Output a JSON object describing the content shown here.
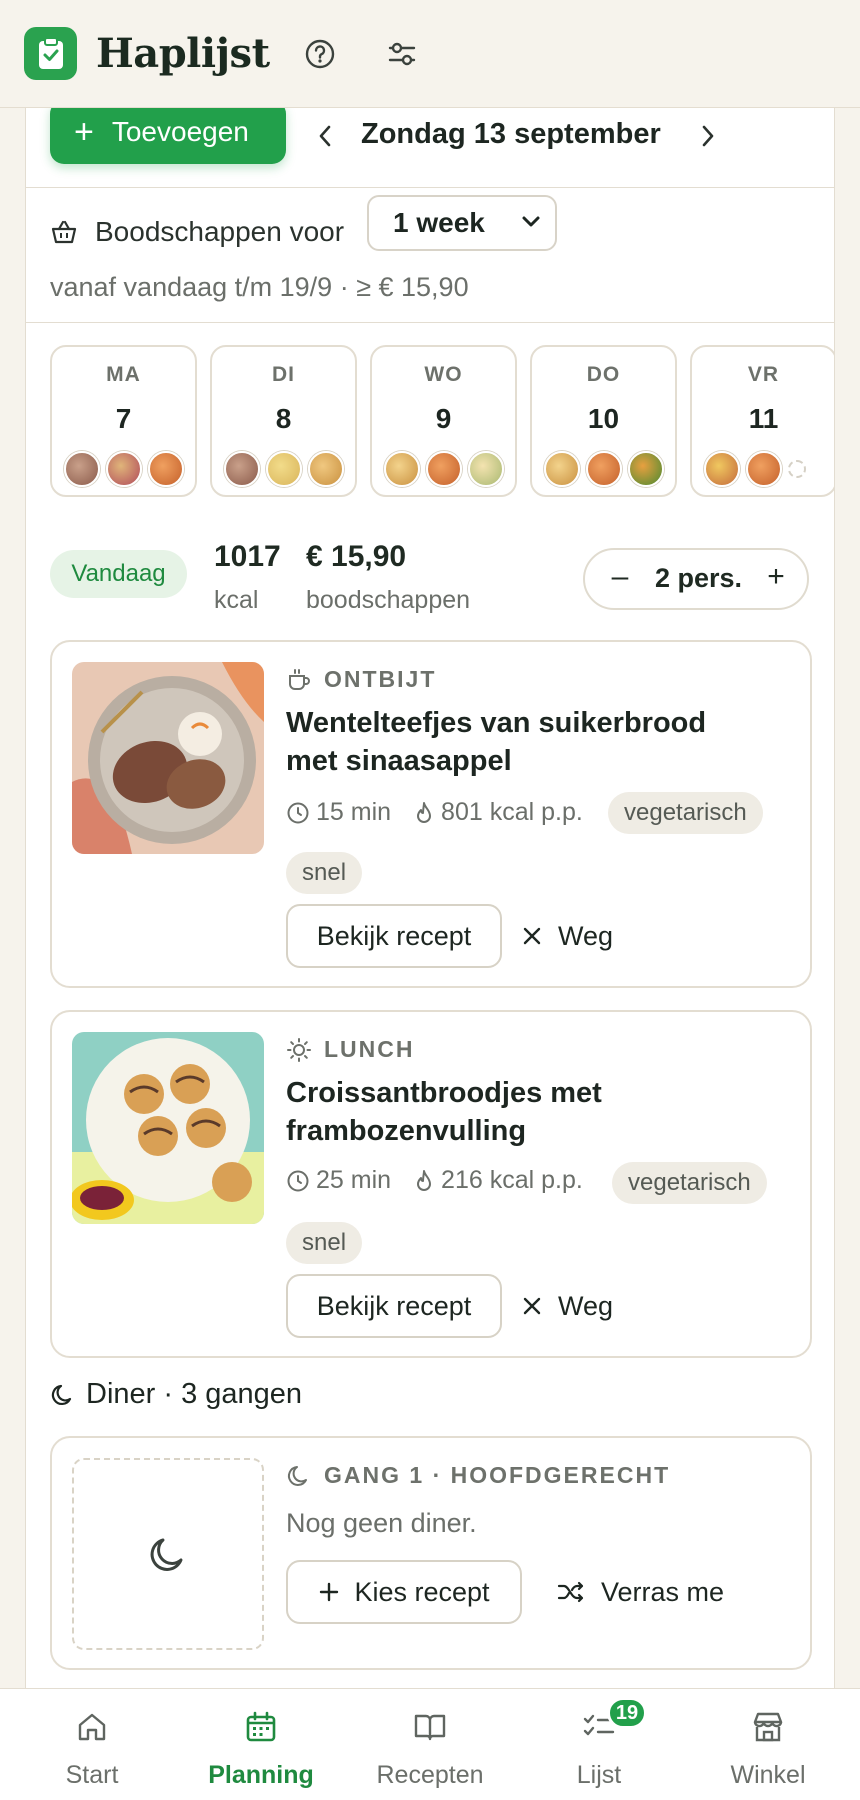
{
  "app": {
    "title": "Haplijst"
  },
  "header": {
    "help_icon": "help-circle-icon",
    "settings_icon": "sliders-icon"
  },
  "toolbar": {
    "add_label": "Toevoegen",
    "date_label": "Zondag 13 september"
  },
  "shopping": {
    "label": "Boodschappen voor",
    "period_value": "1 week",
    "range_text": "vanaf vandaag t/m 19/9 · ≥ € 15,90"
  },
  "days": [
    {
      "name": "MA",
      "num": "7",
      "thumbs": [
        "#8a5a4a",
        "#c48a5e",
        "#d77a3a"
      ]
    },
    {
      "name": "DI",
      "num": "8",
      "thumbs": [
        "#8a5a4a",
        "#d9b45a",
        "#d9a055"
      ]
    },
    {
      "name": "WO",
      "num": "9",
      "thumbs": [
        "#e0b060",
        "#d5722f",
        "#e6c97e"
      ]
    },
    {
      "name": "DO",
      "num": "10",
      "thumbs": [
        "#e0b060",
        "#d5722f",
        "#5a9a3a"
      ]
    },
    {
      "name": "VR",
      "num": "11",
      "thumbs": [
        "#d9a545",
        "#d5722f"
      ]
    }
  ],
  "summary": {
    "today_label": "Vandaag",
    "kcal_value": "1017",
    "kcal_label": "kcal",
    "cost_value": "€ 15,90",
    "cost_label": "boodschappen",
    "persons_value": "2 pers.",
    "minus_label": "–",
    "plus_label": "+"
  },
  "meals": [
    {
      "type": "ONTBIJT",
      "title_line1": "Wentelteefjes van suikerbrood",
      "title_line2": "met sinaasappel",
      "time": "15 min",
      "kcal": "801 kcal p.p.",
      "tags": [
        "vegetarisch",
        "snel"
      ],
      "view_label": "Bekijk recept",
      "remove_label": "Weg"
    },
    {
      "type": "LUNCH",
      "title_line1": "Croissantbroodjes met",
      "title_line2": "frambozenvulling",
      "time": "25 min",
      "kcal": "216 kcal p.p.",
      "tags": [
        "vegetarisch",
        "snel"
      ],
      "view_label": "Bekijk recept",
      "remove_label": "Weg"
    }
  ],
  "diner": {
    "heading": "Diner · 3 gangen",
    "course_label": "GANG 1 · HOOFDGERECHT",
    "empty_text": "Nog geen diner.",
    "choose_label": "Kies recept",
    "surprise_label": "Verras me"
  },
  "bottom_nav": [
    {
      "label": "Start",
      "icon": "home-icon"
    },
    {
      "label": "Planning",
      "icon": "calendar-icon",
      "active": true
    },
    {
      "label": "Recepten",
      "icon": "book-icon"
    },
    {
      "label": "Lijst",
      "icon": "checklist-icon",
      "badge": "19"
    },
    {
      "label": "Winkel",
      "icon": "store-icon"
    }
  ],
  "colors": {
    "brand": "#22a04b",
    "background": "#f6f3ec",
    "text": "#1d2621",
    "muted": "#6b6f6a"
  }
}
